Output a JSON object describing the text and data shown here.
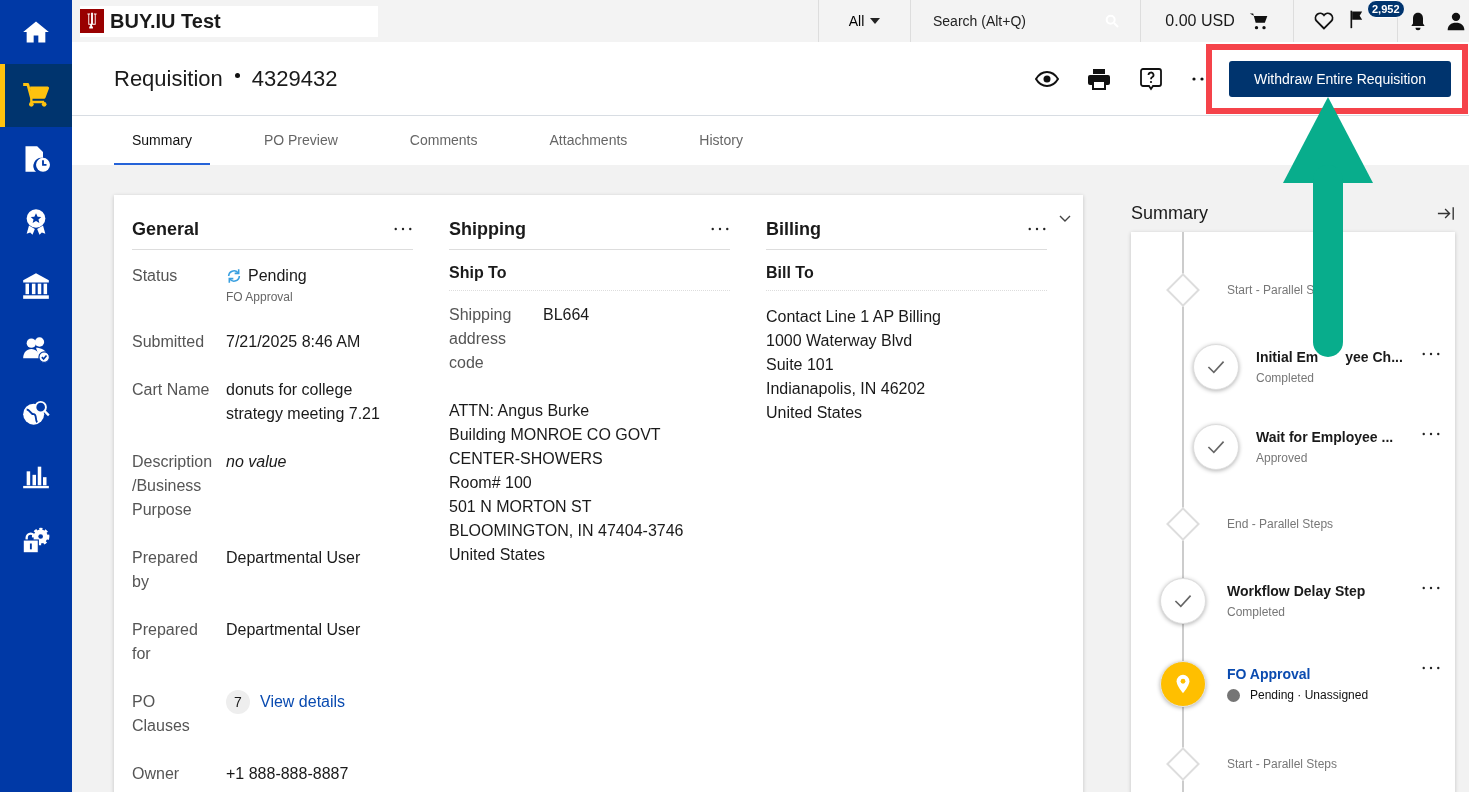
{
  "sidebar": {
    "items": [
      {
        "selected": false
      },
      {
        "selected": true
      },
      {
        "selected": false
      },
      {
        "selected": false
      },
      {
        "selected": false
      },
      {
        "selected": false
      },
      {
        "selected": false
      },
      {
        "selected": false
      },
      {
        "selected": false
      }
    ]
  },
  "topbar": {
    "logo_text": "BUY.IU Test",
    "scope": "All",
    "search": {
      "placeholder": "Search (Alt+Q)"
    },
    "cart_total": "0.00 USD",
    "flag_count": "2,952"
  },
  "header": {
    "title": "Requisition",
    "number": "4329432",
    "primary_button": "Withdraw Entire Requisition"
  },
  "tabs": [
    {
      "label": "Summary",
      "selected": true
    },
    {
      "label": "PO Preview",
      "selected": false
    },
    {
      "label": "Comments",
      "selected": false
    },
    {
      "label": "Attachments",
      "selected": false
    },
    {
      "label": "History",
      "selected": false
    }
  ],
  "general": {
    "title": "General",
    "fields": [
      {
        "label": "Status",
        "kind": "status",
        "value": "Pending",
        "sub": "FO Approval"
      },
      {
        "label": "Submitted",
        "kind": "text",
        "value": "7/21/2025 8:46 AM"
      },
      {
        "label": "Cart Name",
        "kind": "text",
        "value": "donuts for college strategy meeting 7.21"
      },
      {
        "label": "Description /Business Purpose",
        "kind": "empty",
        "value": "no value"
      },
      {
        "label": "Prepared by",
        "kind": "text",
        "value": "Departmental User"
      },
      {
        "label": "Prepared for",
        "kind": "text",
        "value": "Departmental User"
      },
      {
        "label": "PO Clauses",
        "kind": "count-link",
        "count": "7",
        "value": "View details"
      },
      {
        "label": "Owner",
        "kind": "text",
        "value": "+1 888-888-8887"
      }
    ]
  },
  "shipping": {
    "title": "Shipping",
    "subtitle": "Ship To",
    "code_label": "Shipping address code",
    "code": "BL664",
    "address": [
      "ATTN: Angus Burke",
      "Building MONROE CO GOVT CENTER-SHOWERS",
      "Room# 100",
      "501 N MORTON ST",
      "BLOOMINGTON, IN 47404-3746",
      "United States"
    ]
  },
  "billing": {
    "title": "Billing",
    "subtitle": "Bill To",
    "address": [
      "Contact Line 1 AP Billing",
      "1000 Waterway Blvd",
      "Suite 101",
      "Indianapolis, IN 46202",
      "United States"
    ]
  },
  "timeline": {
    "title": "Summary",
    "steps": [
      {
        "kind": "diamond",
        "label": "Start - Parallel S",
        "children": [
          {
            "kind": "check",
            "label": "Initial Em",
            "label_tail": "yee Ch...",
            "status": "Completed"
          },
          {
            "kind": "check",
            "label": "Wait for Employee ...",
            "status": "Approved"
          }
        ]
      },
      {
        "kind": "diamond",
        "label": "End - Parallel Steps"
      },
      {
        "kind": "check",
        "label": "Workflow Delay Step",
        "status": "Completed"
      },
      {
        "kind": "current",
        "label": "FO Approval",
        "status": "Pending · Unassigned"
      },
      {
        "kind": "diamond",
        "label": "Start - Parallel Steps"
      }
    ]
  },
  "annotations": [
    {
      "kind": "frame",
      "color": "#f5434a"
    },
    {
      "kind": "arrow",
      "color": "#08ad8c"
    }
  ]
}
